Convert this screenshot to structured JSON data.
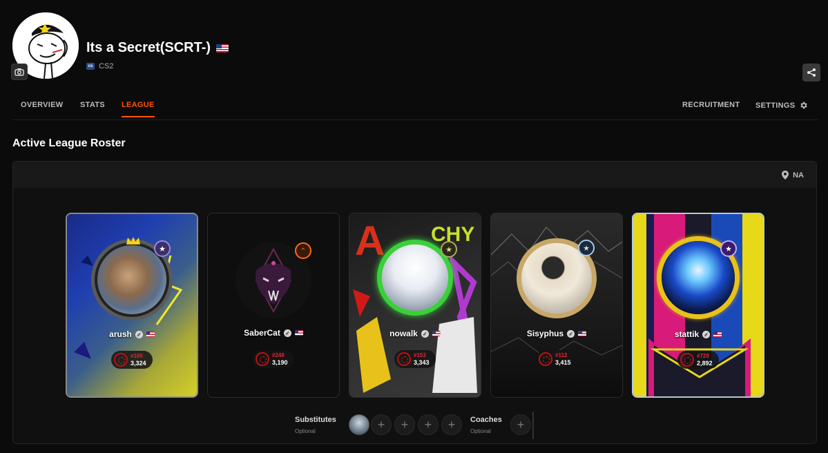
{
  "team": {
    "name": "Its a Secret(SCRT-)",
    "game": "CS2",
    "game_icon_text": "cs"
  },
  "tabs": {
    "overview": "OVERVIEW",
    "stats": "STATS",
    "league": "LEAGUE",
    "recruitment": "RECRUITMENT",
    "settings": "SETTINGS"
  },
  "roster": {
    "title": "Active League Roster",
    "region": "NA",
    "players": [
      {
        "name": "arush",
        "rank": "#165",
        "elo": "3,324"
      },
      {
        "name": "SaberCat",
        "rank": "#248",
        "elo": "3,190"
      },
      {
        "name": "nowalk",
        "rank": "#153",
        "elo": "3,343"
      },
      {
        "name": "Sisyphus",
        "rank": "#112",
        "elo": "3,415"
      },
      {
        "name": "stattik",
        "rank": "#729",
        "elo": "2,892"
      }
    ],
    "substitutes_label": "Substitutes",
    "substitutes_sub": "Optional",
    "coaches_label": "Coaches",
    "coaches_sub": "Optional"
  },
  "colors": {
    "accent": "#ff5500",
    "background": "#0b0b0b"
  },
  "icons": [
    "camera-icon",
    "share-icon",
    "gear-icon",
    "location-pin-icon",
    "verified-icon",
    "plus-icon"
  ]
}
